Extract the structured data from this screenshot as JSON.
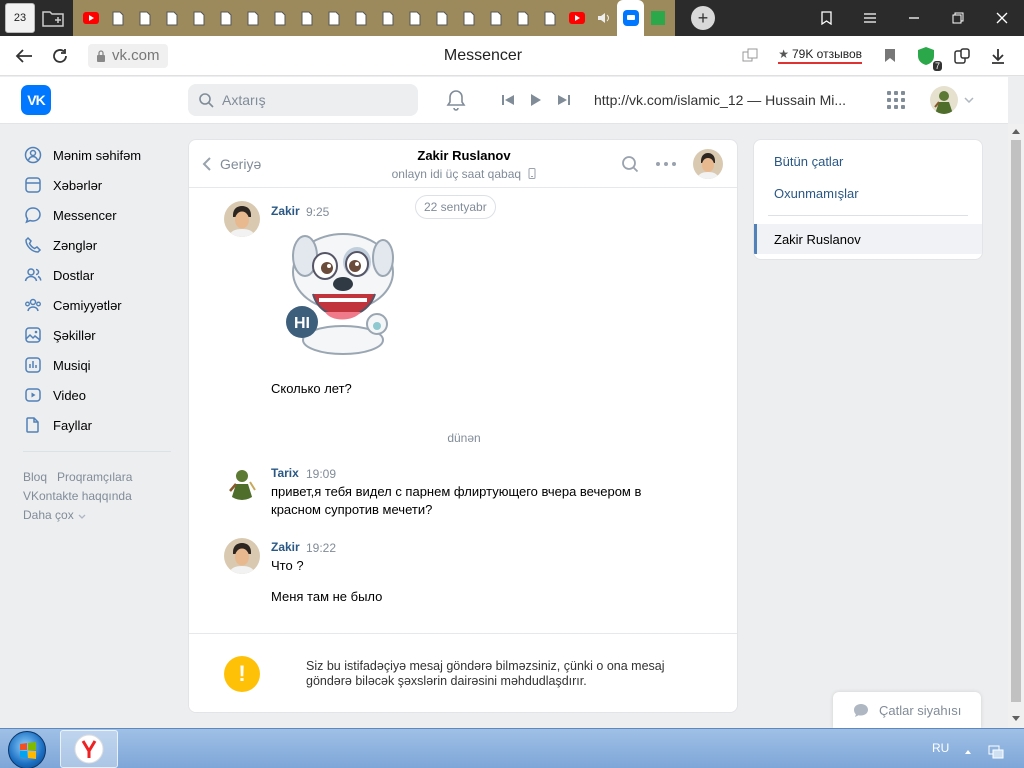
{
  "browser": {
    "tab_counter": "23",
    "page_title": "Messencer",
    "url": "vk.com",
    "reviews": "79K отзывов",
    "shield_badge": "7"
  },
  "header": {
    "search_placeholder": "Axtarış",
    "now_playing": "http://vk.com/islamic_12 — Hussain Mi..."
  },
  "nav": {
    "items": [
      {
        "label": "Mənim səhifəm",
        "icon": "user-circle-icon"
      },
      {
        "label": "Xəbərlər",
        "icon": "newspaper-icon"
      },
      {
        "label": "Messencer",
        "icon": "message-bubble-icon"
      },
      {
        "label": "Zənglər",
        "icon": "phone-icon"
      },
      {
        "label": "Dostlar",
        "icon": "friends-icon"
      },
      {
        "label": "Cəmiyyətlər",
        "icon": "communities-icon"
      },
      {
        "label": "Şəkillər",
        "icon": "photos-icon"
      },
      {
        "label": "Musiqi",
        "icon": "music-icon"
      },
      {
        "label": "Video",
        "icon": "video-icon"
      },
      {
        "label": "Fayllar",
        "icon": "files-icon"
      }
    ],
    "footer": {
      "blog": "Bloq",
      "developers": "Proqramçılara",
      "about": "VKontakte haqqında",
      "more": "Daha çox"
    }
  },
  "chat": {
    "back_label": "Geriyə",
    "peer_name": "Zakir Ruslanov",
    "peer_status": "onlayn idi üç saat qabaq",
    "date_sep_1": "22 sentyabr",
    "date_sep_2": "dünən",
    "messages": [
      {
        "author": "Zakir",
        "time": "9:25",
        "text": "Сколько лет?"
      },
      {
        "author": "Tarix",
        "time": "19:09",
        "text": "привет,я тебя видел с парнем флиртующего вчера вечером в",
        "text2": "красном супротив мечети?"
      },
      {
        "author": "Zakir",
        "time": "19:22",
        "text": "Что ?",
        "text2": "Меня там не было"
      }
    ],
    "sticker_text": "HI",
    "warning_text": "Siz bu istifadəçiyə mesaj göndərə bilməzsiniz, çünki o ona mesaj göndərə biləcək şəxslərin dairəsini məhdudlaşdırır."
  },
  "right_panel": {
    "all_chats": "Bütün çatlar",
    "unread": "Oxunmamışlar",
    "active_chat": "Zakir Ruslanov"
  },
  "chats_list_button": "Çatlar siyahısı",
  "taskbar": {
    "language": "RU"
  },
  "colors": {
    "vk_blue": "#0077ff",
    "link": "#2a5885",
    "muted": "#818c99",
    "warning": "#ffc107"
  }
}
